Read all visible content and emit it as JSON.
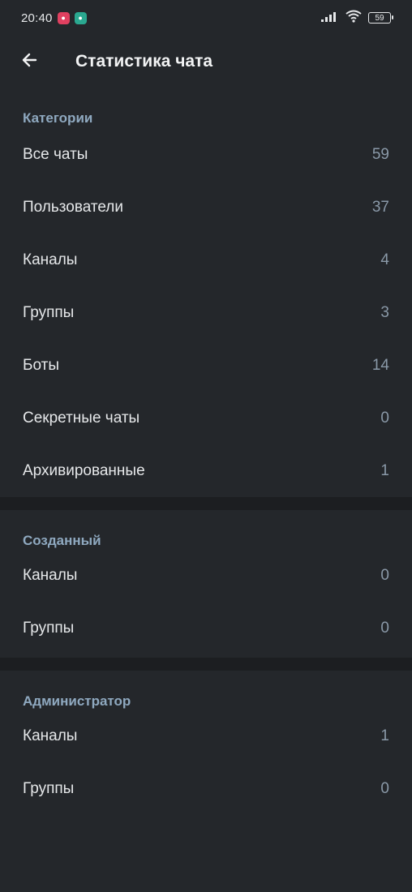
{
  "status_bar": {
    "time": "20:40",
    "battery": "59"
  },
  "header": {
    "title": "Статистика чата"
  },
  "sections": [
    {
      "title": "Категории",
      "rows": [
        {
          "label": "Все чаты",
          "value": "59"
        },
        {
          "label": "Пользователи",
          "value": "37"
        },
        {
          "label": "Каналы",
          "value": "4"
        },
        {
          "label": "Группы",
          "value": "3"
        },
        {
          "label": "Боты",
          "value": "14"
        },
        {
          "label": "Секретные чаты",
          "value": "0"
        },
        {
          "label": "Архивированные",
          "value": "1"
        }
      ]
    },
    {
      "title": "Созданный",
      "rows": [
        {
          "label": "Каналы",
          "value": "0"
        },
        {
          "label": "Группы",
          "value": "0"
        }
      ]
    },
    {
      "title": "Администратор",
      "rows": [
        {
          "label": "Каналы",
          "value": "1"
        },
        {
          "label": "Группы",
          "value": "0"
        }
      ]
    }
  ],
  "colors": {
    "background": "#1c1e21",
    "surface": "#24272b",
    "accent_section_title": "#8fa9c0",
    "value_text": "#8a99a8"
  },
  "icons": {
    "back": "arrow-left-icon",
    "signal": "signal-icon",
    "wifi": "wifi-icon",
    "battery": "battery-icon"
  }
}
